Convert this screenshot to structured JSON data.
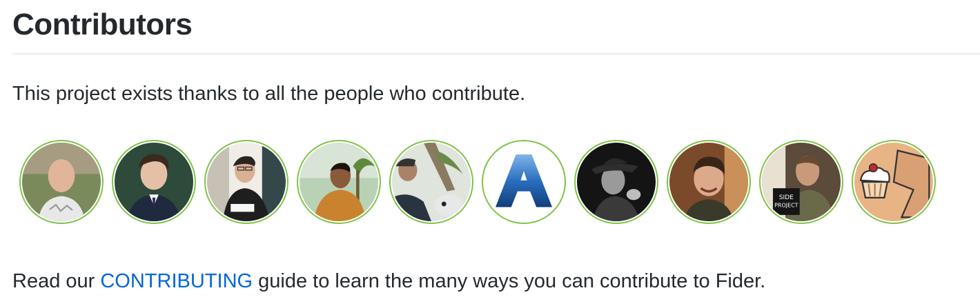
{
  "section": {
    "title": "Contributors",
    "intro": "This project exists thanks to all the people who contribute."
  },
  "avatars": [
    {
      "icon": "person-avatar-icon",
      "tone": "#a07860"
    },
    {
      "icon": "person-avatar-icon",
      "tone": "#2d4a3a"
    },
    {
      "icon": "person-avatar-icon",
      "tone": "#f0ece6"
    },
    {
      "icon": "person-avatar-icon",
      "tone": "#c9822e"
    },
    {
      "icon": "person-avatar-icon",
      "tone": "#9aa890"
    },
    {
      "icon": "letter-a-logo-icon",
      "tone": "#1f5fa8"
    },
    {
      "icon": "person-avatar-icon",
      "tone": "#222222"
    },
    {
      "icon": "person-avatar-icon",
      "tone": "#8a5a3c"
    },
    {
      "icon": "person-avatar-icon",
      "tone": "#5c4a3a"
    },
    {
      "icon": "cupcake-avatar-icon",
      "tone": "#e8b486"
    }
  ],
  "footer": {
    "prefix": "Read our ",
    "link": "CONTRIBUTING",
    "suffix": " guide to learn the many ways you can contribute to Fider."
  },
  "colors": {
    "avatar_border": "#7fc347",
    "link": "#0366d6",
    "text": "#24292e"
  }
}
